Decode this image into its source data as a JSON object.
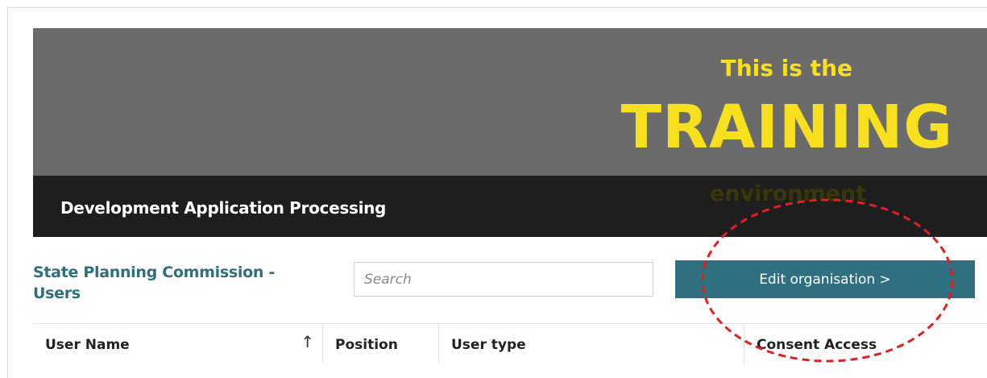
{
  "banner": {
    "line1": "This is the",
    "line2": "TRAINING",
    "line3": "environment"
  },
  "header": {
    "app_title": "Development Application Processing"
  },
  "organisation": {
    "title": "State Planning Commission - Users"
  },
  "search": {
    "placeholder": "Search"
  },
  "actions": {
    "edit_label": "Edit organisation >"
  },
  "table": {
    "columns": [
      "User Name",
      "Position",
      "User type",
      "Consent Access"
    ],
    "sort_icon": "arrow-up-icon"
  },
  "colors": {
    "banner_bg": "#6b6b6b",
    "banner_text": "#f7e01d",
    "subheader_bg": "#1e1e1e",
    "accent": "#2f6f80",
    "annotation": "#e02020"
  }
}
